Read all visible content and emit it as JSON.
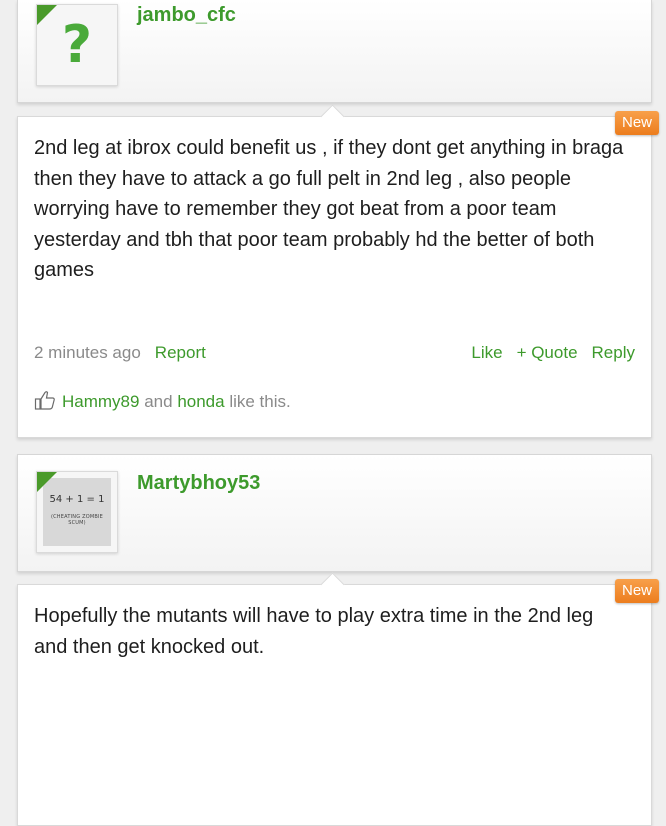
{
  "posts": [
    {
      "username": "jambo_cfc",
      "avatar_icon": "question-mark-icon",
      "avatar_glyph": "?",
      "badge": "New",
      "message": "2nd leg at ibrox could benefit us , if they dont get anything in braga then they have to attack a go full pelt in 2nd leg , also people worrying have to remember they got beat from a poor team yesterday and tbh that poor team probably hd the better of both games",
      "time": "2 minutes ago",
      "report": "Report",
      "actions": {
        "like": "Like",
        "quote": "+ Quote",
        "reply": "Reply"
      },
      "likes": {
        "user1": "Hammy89",
        "and": "and",
        "user2": "honda",
        "suffix": "like this."
      }
    },
    {
      "username": "Martybhoy53",
      "avatar_text_1": "54 + 1 = 1",
      "avatar_text_2": "(CHEATING ZOMBIE SCUM)",
      "badge": "New",
      "message": "Hopefully the mutants will have to play extra time in the 2nd leg and then get knocked out."
    }
  ],
  "colors": {
    "accent": "#3d9a2c",
    "badge": "#ec7d1e",
    "meta": "#8a8a8a"
  }
}
